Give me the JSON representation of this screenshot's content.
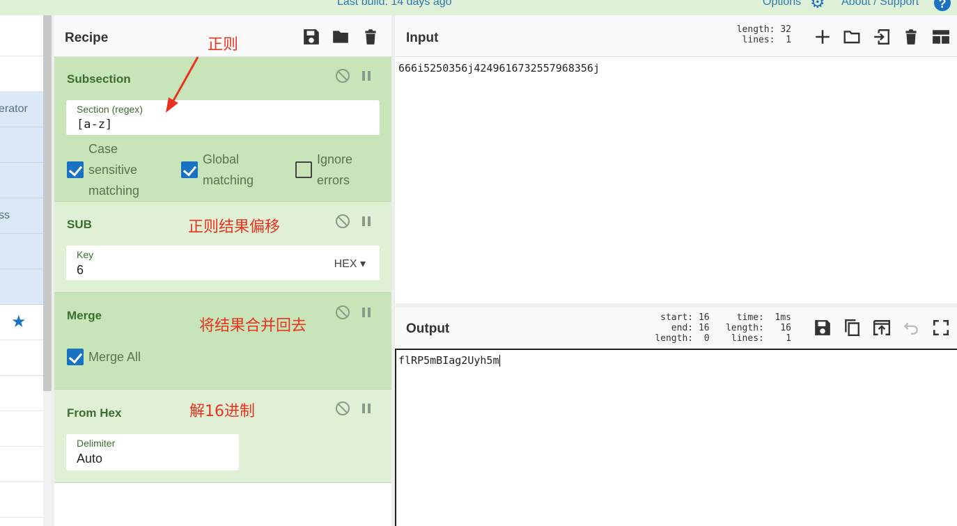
{
  "banner": {
    "last_build": "Last build: 14 days ago",
    "options": "Options",
    "options_icon": "gear-icon",
    "about": "About / Support",
    "help_icon": "question-circle-icon",
    "help_glyph": "?"
  },
  "operations": {
    "partial_items": [
      "",
      "",
      "erator",
      "",
      "",
      "ss",
      "",
      "",
      "",
      "",
      "",
      "",
      "",
      ""
    ],
    "favourite_icon": "star-icon"
  },
  "recipe": {
    "title": "Recipe",
    "icons": [
      "save-icon",
      "folder-icon",
      "trash-icon"
    ],
    "ops": [
      {
        "name": "Subsection",
        "field_label": "Section (regex)",
        "field_value": "[a-z]",
        "checkboxes": [
          {
            "label": "Case sensitive matching",
            "lines": [
              "Case",
              "sensitive",
              "matching"
            ],
            "checked": true
          },
          {
            "label": "Global matching",
            "lines": [
              "Global",
              "matching"
            ],
            "checked": true
          },
          {
            "label": "Ignore errors",
            "lines": [
              "Ignore",
              "errors"
            ],
            "checked": false
          }
        ]
      },
      {
        "name": "SUB",
        "field_label": "Key",
        "field_value": "6",
        "format": "HEX"
      },
      {
        "name": "Merge",
        "checkboxes": [
          {
            "label": "Merge All",
            "checked": true
          }
        ]
      },
      {
        "name": "From Hex",
        "field_label": "Delimiter",
        "field_value": "Auto"
      }
    ],
    "annotations": {
      "regex": "正则",
      "offset": "正则结果偏移",
      "merge": "将结果合并回去",
      "hex": "解16进制"
    }
  },
  "input": {
    "title": "Input",
    "stats_text": "length: 32\n lines:  1",
    "text": "666i5250356j4249616732557968356j",
    "icons": [
      "plus-icon",
      "folder-icon",
      "import-icon",
      "trash-icon",
      "layout-icon"
    ]
  },
  "output": {
    "title": "Output",
    "stats_text": "start: 16     time:  1ms\n  end: 16   length:   16\nlength:  0    lines:    1",
    "text": "flRP5mBIag2Uyh5m",
    "icons": [
      "save-icon",
      "copy-icon",
      "replace-input-icon",
      "undo-icon",
      "fullscreen-icon"
    ]
  }
}
